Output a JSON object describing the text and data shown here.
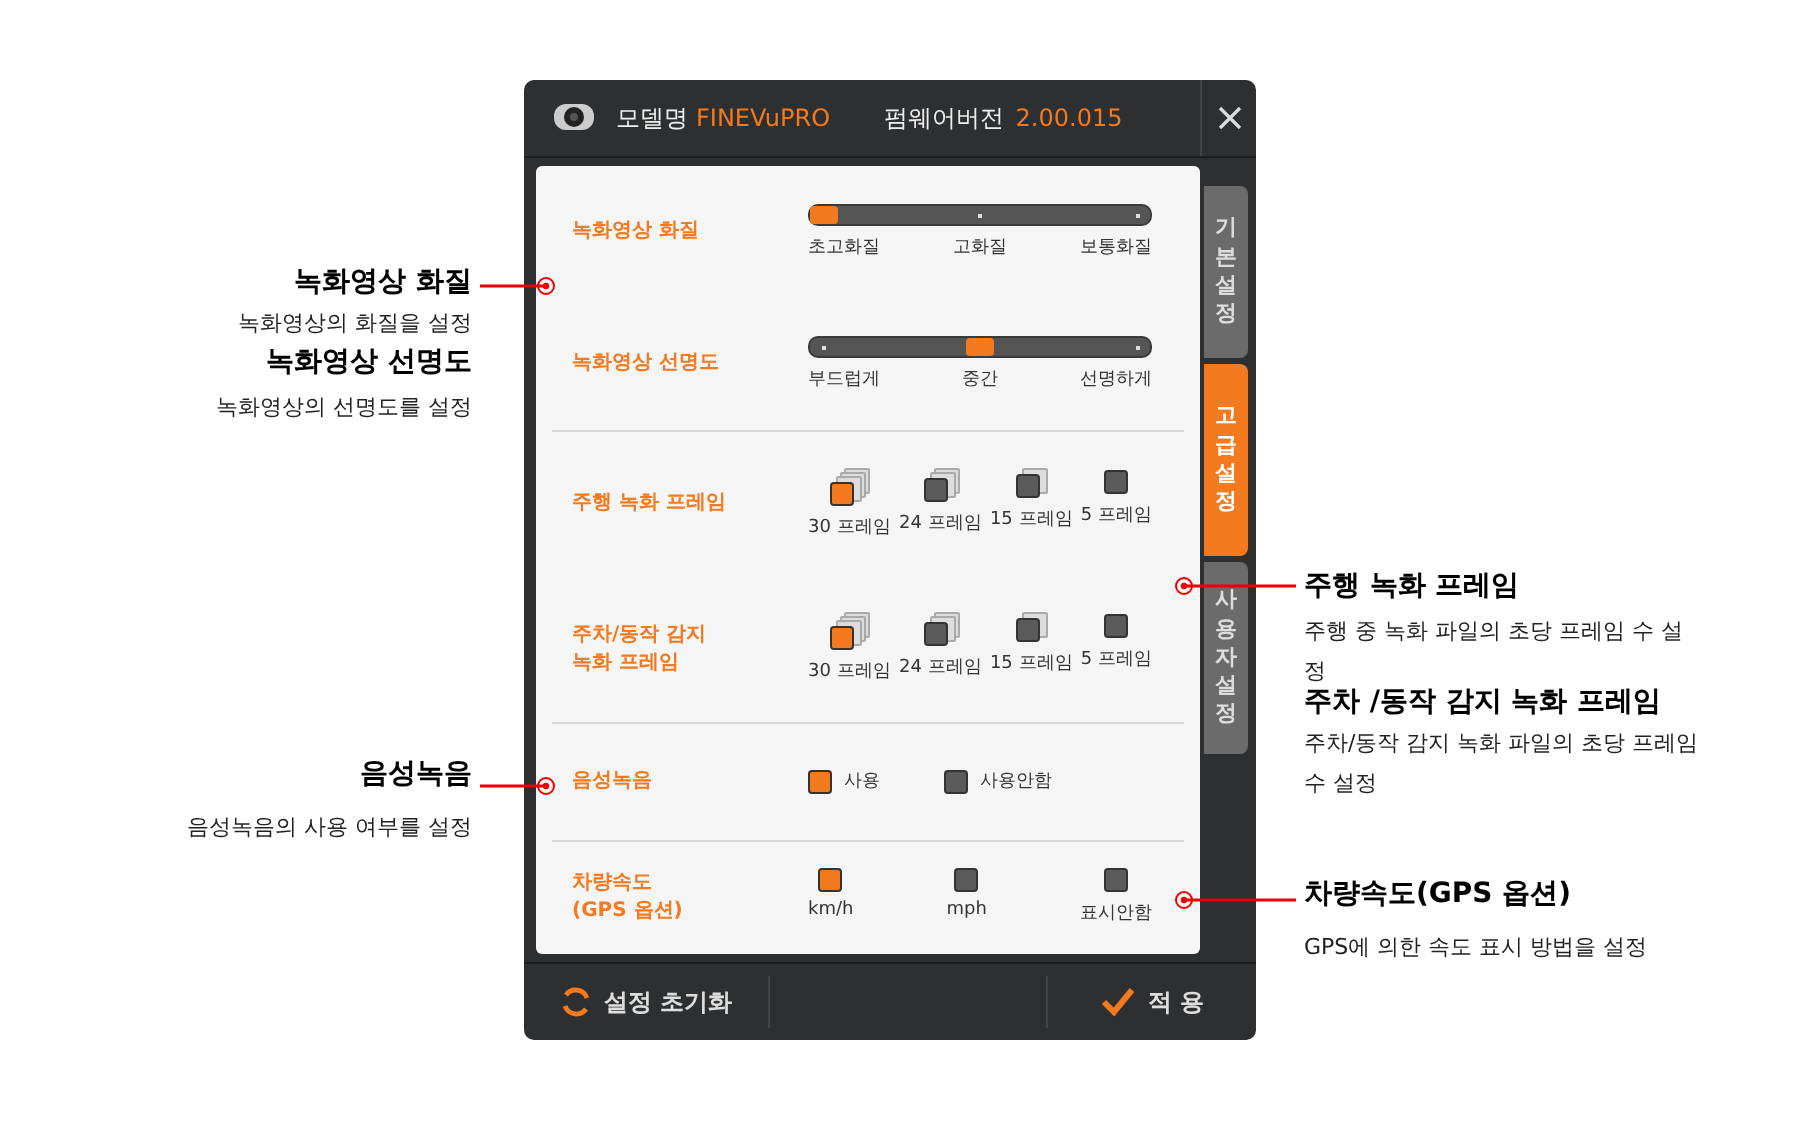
{
  "header": {
    "model_label": "모델명",
    "model_value": "FINEVuPRO",
    "firmware_label": "펌웨어버전",
    "firmware_value": "2.00.015"
  },
  "tabs": [
    {
      "label": "기본설정",
      "selected": false
    },
    {
      "label": "고급설정",
      "selected": true
    },
    {
      "label": "사용자설정",
      "selected": false
    }
  ],
  "sections": [
    {
      "rows": [
        {
          "kind": "slider",
          "label": "녹화영상 화질",
          "level": 0,
          "options": [
            "초고화질",
            "고화질",
            "보통화질"
          ]
        },
        {
          "kind": "slider",
          "label": "녹화영상 선명도",
          "level": 0.5,
          "options": [
            "부드럽게",
            "중간",
            "선명하게"
          ]
        }
      ]
    },
    {
      "rows": [
        {
          "kind": "frames",
          "label": "주행 녹화 프레임",
          "options": [
            {
              "label": "30 프레임",
              "selected": true
            },
            {
              "label": "24 프레임",
              "selected": false
            },
            {
              "label": "15 프레임",
              "selected": false
            },
            {
              "label": "5 프레임",
              "selected": false
            }
          ]
        },
        {
          "kind": "frames",
          "label": "주차/동작 감지\n녹화 프레임",
          "options": [
            {
              "label": "30 프레임",
              "selected": true
            },
            {
              "label": "24 프레임",
              "selected": false
            },
            {
              "label": "15 프레임",
              "selected": false
            },
            {
              "label": "5 프레임",
              "selected": false
            }
          ]
        }
      ]
    },
    {
      "rows": [
        {
          "kind": "radio",
          "label": "음성녹음",
          "options": [
            {
              "label": "사용",
              "selected": true
            },
            {
              "label": "사용안함",
              "selected": false
            }
          ]
        }
      ]
    },
    {
      "rows": [
        {
          "kind": "stacked",
          "label": "차량속도\n(GPS 옵션)",
          "options": [
            {
              "label": "km/h",
              "selected": true
            },
            {
              "label": "mph",
              "selected": false
            },
            {
              "label": "표시안함",
              "selected": false
            }
          ]
        }
      ]
    }
  ],
  "footer": {
    "reset": "설정 초기화",
    "apply": "적 용"
  },
  "callouts_left": [
    {
      "title": "녹화영상 화질",
      "text": "녹화영상의 화질을 설정"
    },
    {
      "title": "녹화영상 선명도",
      "text": "녹화영상의 선명도를 설정"
    },
    {
      "title": "음성녹음",
      "text": "음성녹음의 사용 여부를 설정"
    }
  ],
  "callouts_right": [
    {
      "title": "주행 녹화 프레임",
      "text": "주행 중 녹화 파일의 초당 프레임 수 설정"
    },
    {
      "title": "주차 /동작 감지 녹화 프레임",
      "text": "주차/동작 감지 녹화 파일의 초당 프레임 수 설정"
    },
    {
      "title": "차량속도(GPS 옵션)",
      "text": "GPS에 의한 속도 표시 방법을 설정"
    }
  ]
}
